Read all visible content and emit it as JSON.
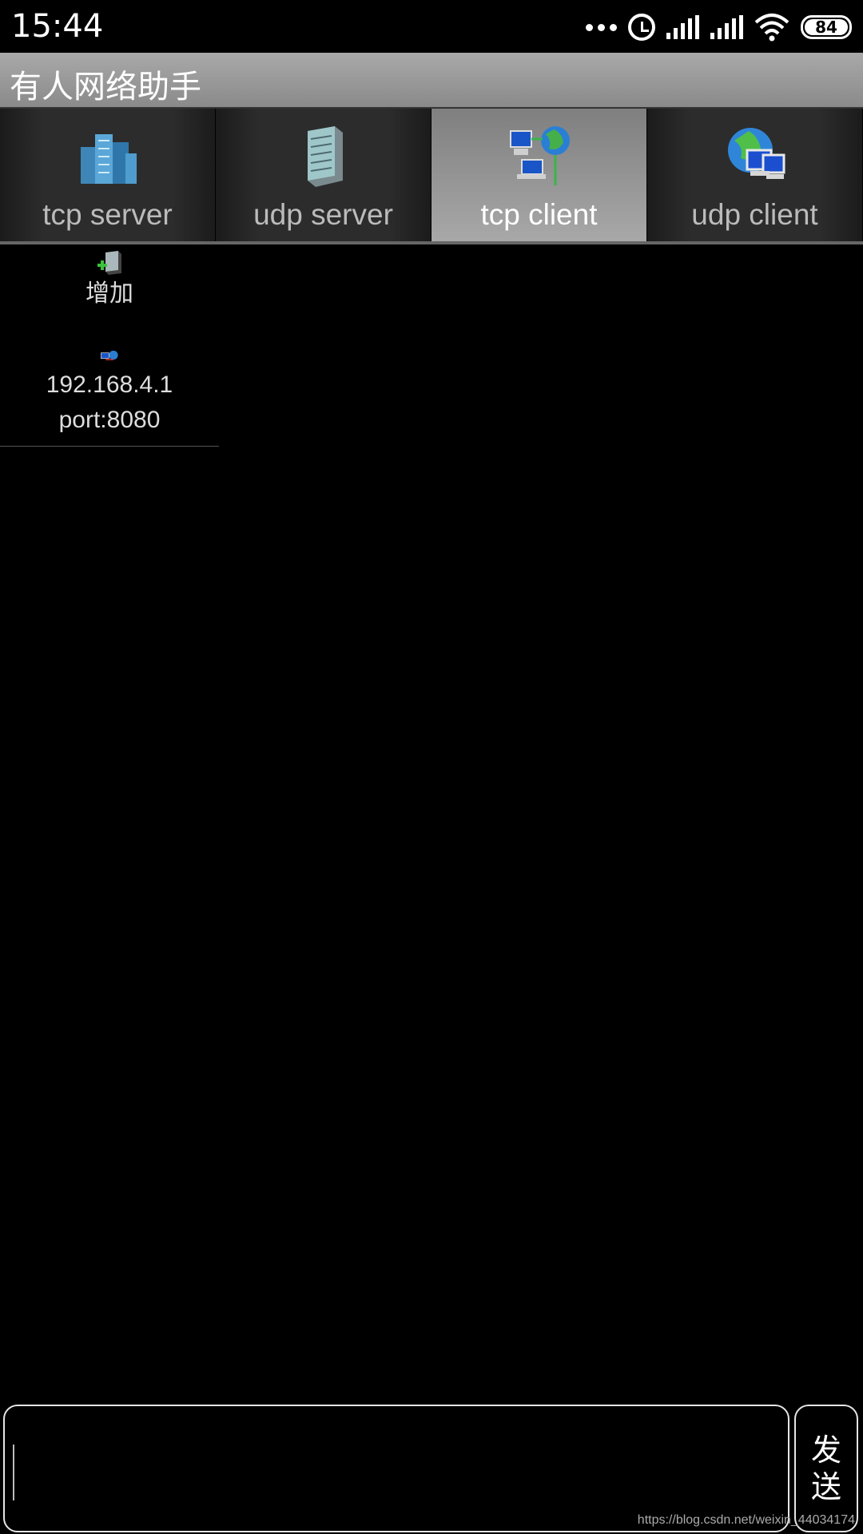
{
  "status_bar": {
    "time": "15:44",
    "battery": "84",
    "icons": [
      "more-dots-icon",
      "alarm-icon",
      "signal-icon",
      "signal-icon",
      "wifi-icon",
      "battery-icon"
    ]
  },
  "app": {
    "title": "有人网络助手"
  },
  "tabs": [
    {
      "label": "tcp server",
      "icon": "server-buildings-icon",
      "active": false
    },
    {
      "label": "udp server",
      "icon": "server-tower-icon",
      "active": false
    },
    {
      "label": "tcp client",
      "icon": "network-computers-globe-icon",
      "active": true
    },
    {
      "label": "udp client",
      "icon": "globe-computers-icon",
      "active": false
    }
  ],
  "list": {
    "add_label": "增加",
    "connections": [
      {
        "ip": "192.168.4.1",
        "port": "port:8080"
      }
    ]
  },
  "input": {
    "value": "",
    "placeholder": ""
  },
  "send_button": {
    "label": "发送"
  },
  "watermark": "https://blog.csdn.net/weixin_44034174",
  "colors": {
    "background": "#000000",
    "titlebar": "#999999",
    "active_tab": "#a0a0a0"
  }
}
